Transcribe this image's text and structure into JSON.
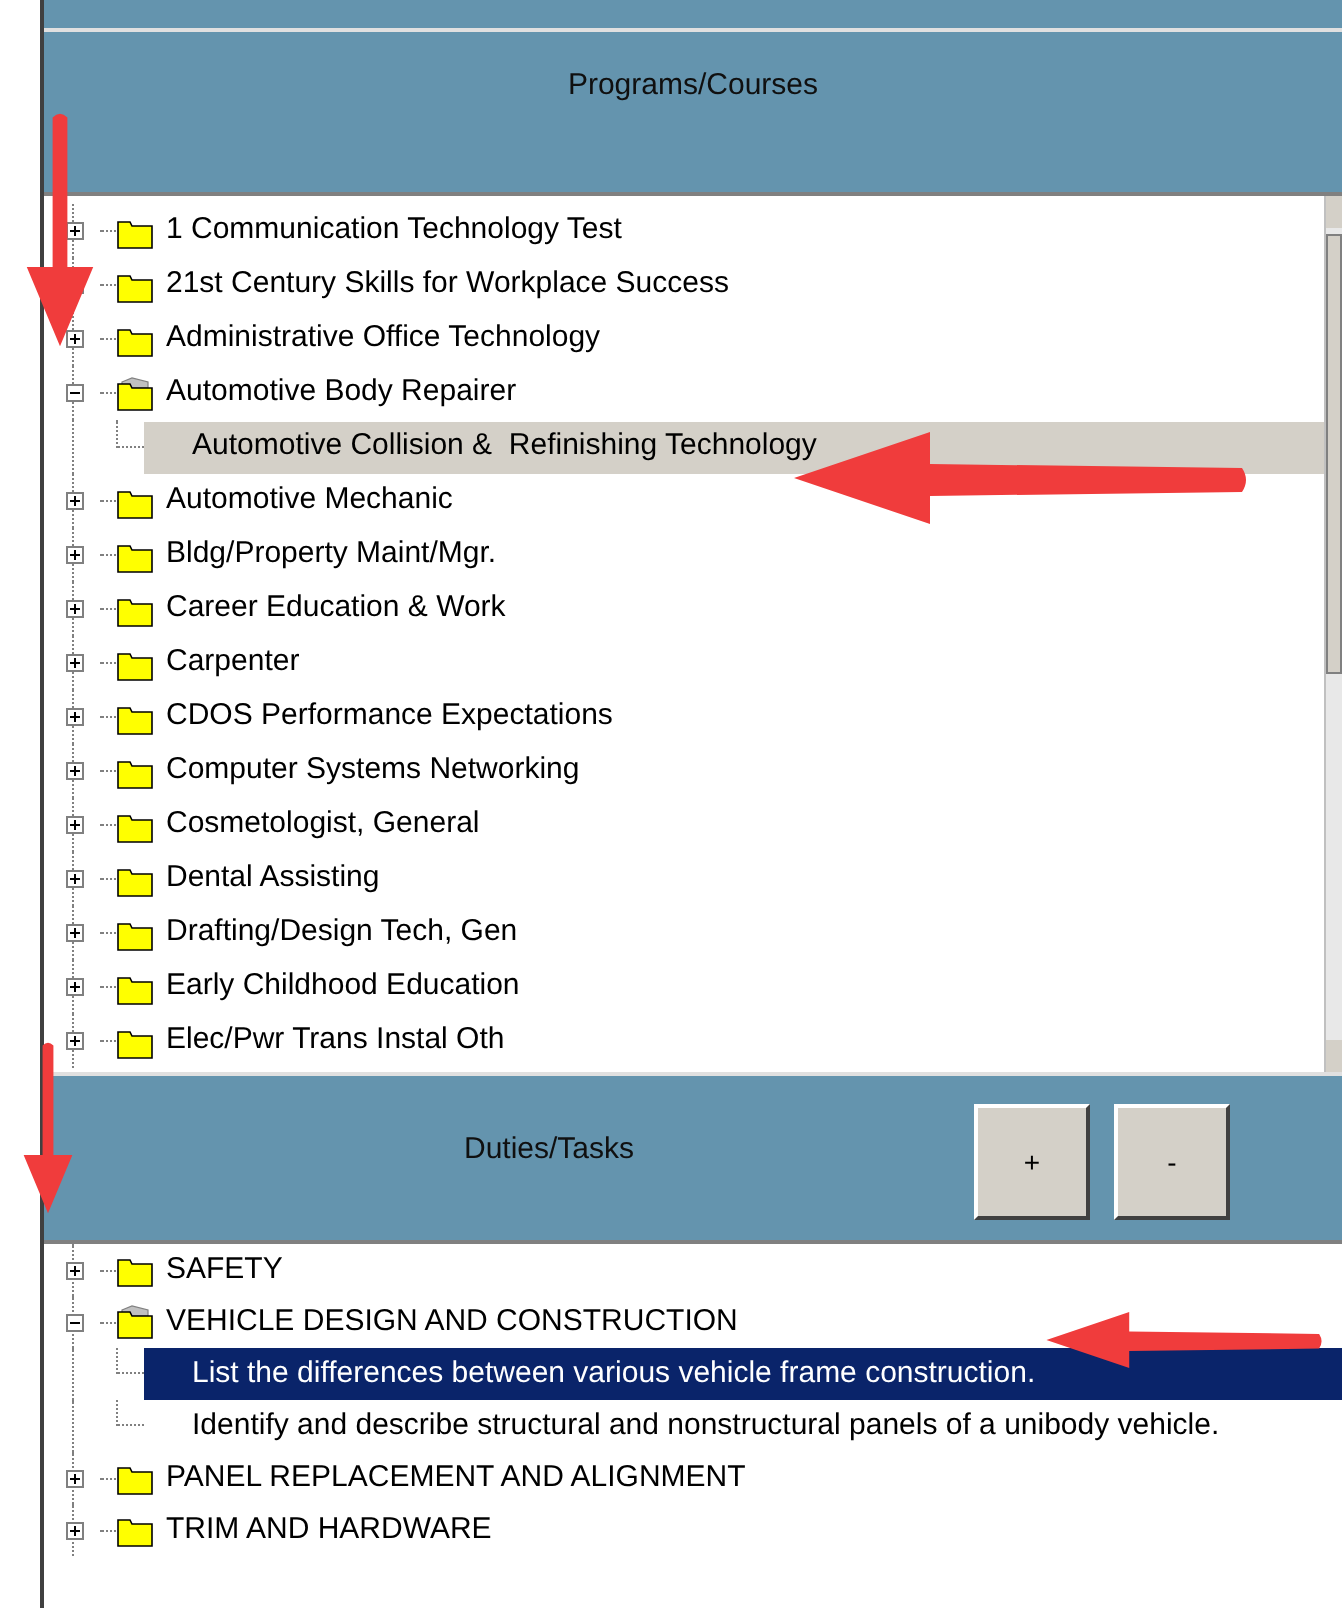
{
  "programs": {
    "title": "Programs/Courses",
    "items": [
      {
        "label": "1 Communication Technology Test",
        "expanded": false,
        "selected": false
      },
      {
        "label": "21st Century Skills for Workplace Success",
        "expanded": false,
        "selected": false
      },
      {
        "label": "Administrative Office Technology",
        "expanded": false,
        "selected": false
      },
      {
        "label": "Automotive Body Repairer",
        "expanded": true,
        "selected": false,
        "children": [
          {
            "label": "Automotive Collision &  Refinishing Technology",
            "selected": true
          }
        ]
      },
      {
        "label": "Automotive Mechanic",
        "expanded": false,
        "selected": false
      },
      {
        "label": "Bldg/Property Maint/Mgr.",
        "expanded": false,
        "selected": false
      },
      {
        "label": "Career Education & Work",
        "expanded": false,
        "selected": false
      },
      {
        "label": "Carpenter",
        "expanded": false,
        "selected": false
      },
      {
        "label": "CDOS Performance Expectations",
        "expanded": false,
        "selected": false
      },
      {
        "label": "Computer Systems Networking",
        "expanded": false,
        "selected": false
      },
      {
        "label": "Cosmetologist, General",
        "expanded": false,
        "selected": false
      },
      {
        "label": "Dental Assisting",
        "expanded": false,
        "selected": false
      },
      {
        "label": "Drafting/Design Tech, Gen",
        "expanded": false,
        "selected": false
      },
      {
        "label": "Early Childhood Education",
        "expanded": false,
        "selected": false
      },
      {
        "label": "Elec/Pwr Trans Instal Oth",
        "expanded": false,
        "selected": false
      }
    ]
  },
  "duties": {
    "title": "Duties/Tasks",
    "buttons": [
      "+",
      "-"
    ],
    "items": [
      {
        "label": "SAFETY",
        "expanded": false,
        "selected": false
      },
      {
        "label": "VEHICLE DESIGN AND CONSTRUCTION",
        "expanded": true,
        "selected": false,
        "children": [
          {
            "label": "List the differences between various vehicle frame construction.",
            "selected": true
          },
          {
            "label": "Identify and describe structural and nonstructural panels of a unibody vehicle.",
            "selected": false
          }
        ]
      },
      {
        "label": "PANEL REPLACEMENT AND ALIGNMENT",
        "expanded": false,
        "selected": false
      },
      {
        "label": "TRIM AND HARDWARE",
        "expanded": false,
        "selected": false
      }
    ]
  }
}
